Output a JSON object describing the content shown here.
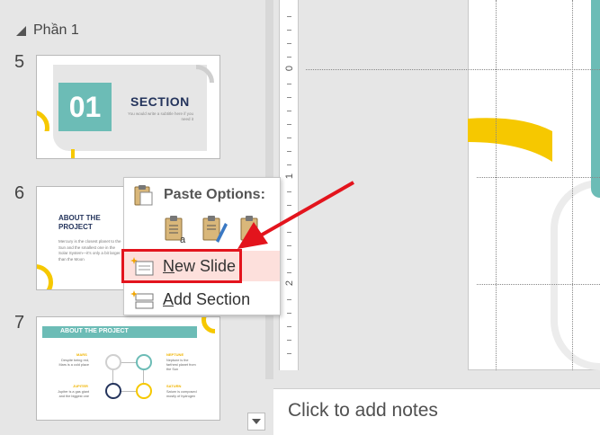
{
  "slide_panel": {
    "section_label": "Phần 1",
    "slides": [
      {
        "number": "5",
        "title": "SECTION",
        "badge": "01",
        "subtitle": "You would write a subtitle here if you need it"
      },
      {
        "number": "6",
        "title": "ABOUT THE PROJECT",
        "body": "Mercury is the closest planet to the Sun and the smallest one in the Solar System—it's only a bit larger than the Moon"
      },
      {
        "number": "7",
        "title": "ABOUT THE PROJECT",
        "items": [
          {
            "label": "MARS",
            "text": "Despite being red, Mars is a cold place"
          },
          {
            "label": "NEPTUNE",
            "text": "Neptune is the farthest planet from the Sun"
          },
          {
            "label": "JUPITER",
            "text": "Jupiter is a gas giant and the biggest one"
          },
          {
            "label": "SATURN",
            "text": "Saturn is composed mostly of hydrogen"
          }
        ]
      }
    ]
  },
  "ruler": {
    "labels": [
      "0",
      "1",
      "2"
    ]
  },
  "notes": {
    "placeholder": "Click to add notes"
  },
  "context_menu": {
    "paste_header": "Paste Options:",
    "paste_options": [
      "use-destination-theme-icon",
      "keep-source-formatting-icon",
      "picture-icon"
    ],
    "items": [
      {
        "accel": "N",
        "rest": "ew Slide"
      },
      {
        "accel": "A",
        "rest": "dd Section"
      }
    ]
  },
  "colors": {
    "accent_teal": "#6cbcb6",
    "accent_yellow": "#f6c800",
    "navy": "#24345c",
    "highlight_red": "#e3141d",
    "hover_pink": "#fde0dc"
  }
}
